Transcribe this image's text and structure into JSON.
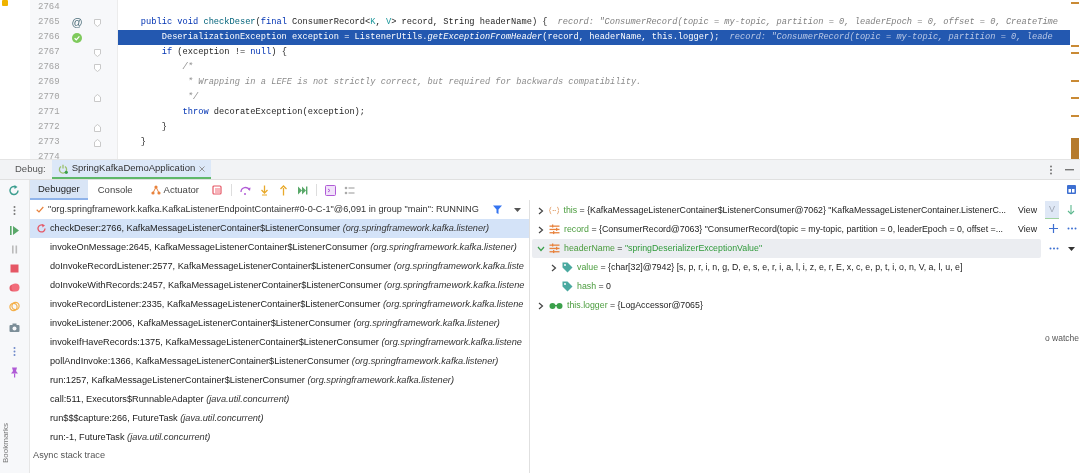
{
  "editor": {
    "lines": [
      {
        "number": "2764",
        "current": false
      },
      {
        "number": "2765",
        "current": false,
        "annotation": "@",
        "fold_start": true,
        "segments": [
          {
            "kind": "kw",
            "text": "    public void "
          },
          {
            "kind": "fn",
            "text": "checkDeser"
          },
          {
            "kind": "plain",
            "text": "("
          },
          {
            "kind": "kw",
            "text": "final "
          },
          {
            "kind": "plain",
            "text": "ConsumerRecord<"
          },
          {
            "kind": "tpk",
            "text": "K"
          },
          {
            "kind": "plain",
            "text": ", "
          },
          {
            "kind": "tpv",
            "text": "V"
          },
          {
            "kind": "plain",
            "text": "> record, String headerName) {"
          },
          {
            "kind": "hint",
            "text": "record: \"ConsumerRecord(topic = my-topic, partition = 0, leaderEpoch = 0, offset = 0, CreateTime"
          }
        ]
      },
      {
        "number": "2766",
        "current": true,
        "breakpoint": true,
        "segments": [
          {
            "kind": "plain",
            "text": "        DeserializationException exception = ListenerUtils."
          },
          {
            "kind": "it",
            "text": "getExceptionFromHeader"
          },
          {
            "kind": "plain",
            "text": "(record, headerName, this.logger);"
          },
          {
            "kind": "hint",
            "text": "record: \"ConsumerRecord(topic = my-topic, partition = 0, leade"
          }
        ]
      },
      {
        "number": "2767",
        "current": false,
        "fold_start": true,
        "segments": [
          {
            "kind": "kw",
            "text": "        if "
          },
          {
            "kind": "plain",
            "text": "(exception != "
          },
          {
            "kind": "kw",
            "text": "null"
          },
          {
            "kind": "plain",
            "text": ") {"
          }
        ]
      },
      {
        "number": "2768",
        "current": false,
        "fold_start": true,
        "segments": [
          {
            "kind": "cm",
            "text": "            /*"
          }
        ]
      },
      {
        "number": "2769",
        "current": false,
        "segments": [
          {
            "kind": "cm",
            "text": "             * Wrapping in a LEFE is not strictly correct, but required for backwards compatibility."
          }
        ]
      },
      {
        "number": "2770",
        "current": false,
        "fold_end": true,
        "segments": [
          {
            "kind": "cm",
            "text": "             */"
          }
        ]
      },
      {
        "number": "2771",
        "current": false,
        "segments": [
          {
            "kind": "kw",
            "text": "            throw "
          },
          {
            "kind": "plain",
            "text": "decorateException(exception);"
          }
        ]
      },
      {
        "number": "2772",
        "current": false,
        "fold_end": true,
        "segments": [
          {
            "kind": "plain",
            "text": "        }"
          }
        ]
      },
      {
        "number": "2773",
        "current": false,
        "fold_end": true,
        "segments": [
          {
            "kind": "plain",
            "text": "    }"
          }
        ]
      },
      {
        "number": "2774",
        "current": false
      }
    ]
  },
  "debug": {
    "label": "Debug:",
    "session_tab": "SpringKafkaDemoApplication",
    "tabs": [
      {
        "label": "Debugger",
        "selected": true,
        "has_icon": false
      },
      {
        "label": "Console",
        "selected": false,
        "has_icon": false
      },
      {
        "label": "Actuator",
        "selected": false,
        "has_icon": true
      }
    ],
    "thread": "\"org.springframework.kafka.KafkaListenerEndpointContainer#0-0-C-1\"@6,091 in group \"main\": RUNNING",
    "frames": [
      {
        "method": "checkDeser:2766, KafkaMessageListenerContainer$ListenerConsumer",
        "package": "(org.springframework.kafka.listener)",
        "selected": true
      },
      {
        "method": "invokeOnMessage:2645, KafkaMessageListenerContainer$ListenerConsumer",
        "package": "(org.springframework.kafka.listener)",
        "selected": false
      },
      {
        "method": "doInvokeRecordListener:2577, KafkaMessageListenerContainer$ListenerConsumer",
        "package": "(org.springframework.kafka.liste",
        "selected": false
      },
      {
        "method": "doInvokeWithRecords:2457, KafkaMessageListenerContainer$ListenerConsumer",
        "package": "(org.springframework.kafka.listene",
        "selected": false
      },
      {
        "method": "invokeRecordListener:2335, KafkaMessageListenerContainer$ListenerConsumer",
        "package": "(org.springframework.kafka.listene",
        "selected": false
      },
      {
        "method": "invokeListener:2006, KafkaMessageListenerContainer$ListenerConsumer",
        "package": "(org.springframework.kafka.listener)",
        "selected": false
      },
      {
        "method": "invokeIfHaveRecords:1375, KafkaMessageListenerContainer$ListenerConsumer",
        "package": "(org.springframework.kafka.listene",
        "selected": false
      },
      {
        "method": "pollAndInvoke:1366, KafkaMessageListenerContainer$ListenerConsumer",
        "package": "(org.springframework.kafka.listener)",
        "selected": false
      },
      {
        "method": "run:1257, KafkaMessageListenerContainer$ListenerConsumer",
        "package": "(org.springframework.kafka.listener)",
        "selected": false
      },
      {
        "method": "call:511, Executors$RunnableAdapter",
        "package": "(java.util.concurrent)",
        "selected": false
      },
      {
        "method": "run$$$capture:266, FutureTask",
        "package": "(java.util.concurrent)",
        "selected": false
      },
      {
        "method": "run:-1, FutureTask",
        "package": "(java.util.concurrent)",
        "selected": false
      }
    ],
    "async_header": "Async stack trace",
    "variables": [
      {
        "kind": "object",
        "name": "this",
        "value": "= {KafkaMessageListenerContainer$ListenerConsumer@7062} \"KafkaMessageListenerContainer.ListenerC...",
        "link": "View",
        "expandable": true,
        "expanded": false,
        "selected": false
      },
      {
        "kind": "field",
        "name": "record",
        "value": "= {ConsumerRecord@7063} \"ConsumerRecord(topic = my-topic, partition = 0, leaderEpoch = 0, offset =...",
        "link": "View",
        "expandable": true,
        "expanded": false,
        "selected": false
      },
      {
        "kind": "field",
        "name": "headerName",
        "value": "= ",
        "string_value": "\"springDeserializerExceptionValue\"",
        "expandable": true,
        "expanded": true,
        "selected": true,
        "children": [
          {
            "kind": "primitive",
            "name": "value",
            "value": "= {char[32]@7942} [s, p, r, i, n, g, D, e, s, e, r, i, a, l, i, z, e, r, E, x, c, e, p, t, i, o, n, V, a, l, u, e]",
            "expandable": true,
            "expanded": false,
            "selected": false
          },
          {
            "kind": "primitive",
            "name": "hash",
            "value": "= 0",
            "expandable": false,
            "selected": false
          }
        ]
      },
      {
        "kind": "watch",
        "name": "this.logger",
        "value": "= {LogAccessor@7065}",
        "expandable": true,
        "expanded": false,
        "selected": false
      }
    ],
    "side_tab": "V",
    "watches_hint": "o watche",
    "bookmarks_label": "Bookmarks"
  }
}
